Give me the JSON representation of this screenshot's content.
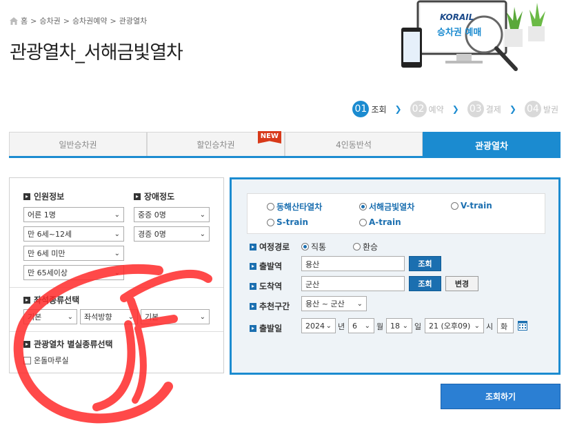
{
  "breadcrumb": [
    "홈",
    "승차권",
    "승차권예약",
    "관광열차"
  ],
  "page_title": "관광열차_서해금빛열차",
  "hero": {
    "brand": "KORAIL",
    "caption": "승차권 예매"
  },
  "steps": [
    {
      "num": "01",
      "label": "조회"
    },
    {
      "num": "02",
      "label": "예약"
    },
    {
      "num": "03",
      "label": "결제"
    },
    {
      "num": "04",
      "label": "발권"
    }
  ],
  "tabs": [
    "일반승차권",
    "할인승차권",
    "4인동반석",
    "관광열차"
  ],
  "new_badge": "NEW",
  "passengers": {
    "title": "인원정보",
    "options": [
      "어른 1명",
      "만 6세~12세",
      "만 6세 미만",
      "만 65세이상"
    ]
  },
  "disability": {
    "title": "장애정도",
    "options": [
      "중증 0명",
      "경증 0명"
    ]
  },
  "seat_type": {
    "title": "좌석종류선택",
    "options": [
      "기본",
      "좌석방향",
      "기본"
    ]
  },
  "special_seat": {
    "title": "관광열차 별실종류선택",
    "checkbox_label": "온돌마루실"
  },
  "trains": [
    "동해산타열차",
    "서해금빛열차",
    "V-train",
    "S-train",
    "A-train"
  ],
  "route": {
    "label": "여정경로",
    "options": [
      "직통",
      "환승"
    ]
  },
  "departure": {
    "label": "출발역",
    "value": "용산",
    "button": "조회"
  },
  "arrival": {
    "label": "도착역",
    "value": "군산",
    "button": "조회",
    "swap_button": "변경"
  },
  "recommend": {
    "label": "추천구간",
    "value": "용산 ~ 군산"
  },
  "date": {
    "label": "출발일",
    "year": "2024",
    "year_unit": "년",
    "month": "6",
    "month_unit": "월",
    "day": "18",
    "day_unit": "일",
    "hour": "21 (오후09)",
    "hour_unit": "시",
    "weekday": "화"
  },
  "search_button": "조회하기",
  "colors": {
    "accent": "#1b8bd0",
    "button": "#2b7fd3",
    "annotation": "#ff2020"
  }
}
